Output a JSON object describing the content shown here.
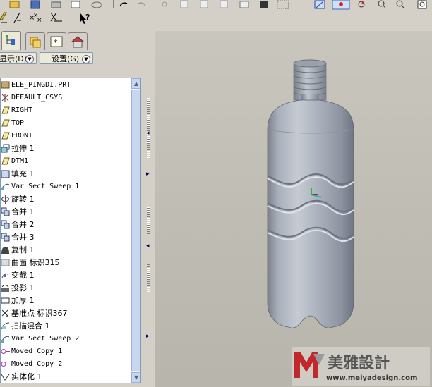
{
  "toolbar": {
    "icons_row1": [
      "folder-open-icon",
      "save-icon",
      "print-icon",
      "mail-icon",
      "undo-icon",
      "redo-icon",
      "cut-icon",
      "copy-icon",
      "paste-icon",
      "paste-special-icon",
      "regenerate-icon",
      "find-icon",
      "select-box-icon",
      "repaint-icon",
      "spin-center-icon",
      "zoom-in-icon",
      "zoom-out-icon",
      "refit-icon"
    ],
    "icons_row2": [
      "datum-plane-toggle-icon",
      "datum-axis-toggle-icon",
      "datum-point-toggle-icon",
      "csys-toggle-icon",
      "context-help-icon"
    ],
    "help_label": "?"
  },
  "panel": {
    "tabs": [
      "model-tree-tab",
      "folder-browser-tab",
      "favorites-tab",
      "connections-tab"
    ],
    "show_menu_label": "显示(D)",
    "settings_menu_label": "设置(G)"
  },
  "tree": {
    "items": [
      {
        "label": "ELE_PINGDI.PRT",
        "icon": "part-icon",
        "cn": false
      },
      {
        "label": "DEFAULT_CSYS",
        "icon": "csys-icon",
        "cn": false
      },
      {
        "label": "RIGHT",
        "icon": "datum-plane-icon",
        "cn": false
      },
      {
        "label": "TOP",
        "icon": "datum-plane-icon",
        "cn": false
      },
      {
        "label": "FRONT",
        "icon": "datum-plane-icon",
        "cn": false
      },
      {
        "label": "拉伸 1",
        "icon": "extrude-icon",
        "cn": true
      },
      {
        "label": "DTM1",
        "icon": "datum-plane-icon",
        "cn": false
      },
      {
        "label": "填充 1",
        "icon": "fill-icon",
        "cn": true
      },
      {
        "label": "Var Sect Sweep 1",
        "icon": "var-sect-sweep-icon",
        "cn": false
      },
      {
        "label": "旋转 1",
        "icon": "revolve-icon",
        "cn": true
      },
      {
        "label": "合并 1",
        "icon": "merge-icon",
        "cn": true
      },
      {
        "label": "合并 2",
        "icon": "merge-icon",
        "cn": true
      },
      {
        "label": "合并 3",
        "icon": "merge-icon",
        "cn": true
      },
      {
        "label": "复制 1",
        "icon": "copy-feature-icon",
        "cn": true
      },
      {
        "label": "曲面 标识315",
        "icon": "surface-icon",
        "cn": true
      },
      {
        "label": "交截 1",
        "icon": "intersect-icon",
        "cn": true
      },
      {
        "label": "投影 1",
        "icon": "project-icon",
        "cn": true
      },
      {
        "label": "加厚 1",
        "icon": "thicken-icon",
        "cn": true
      },
      {
        "label": "基准点 标识367",
        "icon": "datum-point-icon",
        "cn": true
      },
      {
        "label": "扫描混合 1",
        "icon": "swept-blend-icon",
        "cn": true
      },
      {
        "label": "Var Sect Sweep 2",
        "icon": "var-sect-sweep-icon",
        "cn": false
      },
      {
        "label": "Moved Copy 1",
        "icon": "moved-copy-icon",
        "cn": false
      },
      {
        "label": "Moved Copy 2",
        "icon": "moved-copy-icon",
        "cn": false
      },
      {
        "label": "实体化 1",
        "icon": "solidify-icon",
        "cn": true
      }
    ]
  },
  "viewport": {
    "model": "plastic-bottle-model",
    "background": "#c3c0b7",
    "bottle_color": "#a3aab6"
  },
  "watermark": {
    "brand_text": "美雅設計",
    "url_text": "www.meiyadesign.com",
    "accent": "#c0282e"
  }
}
